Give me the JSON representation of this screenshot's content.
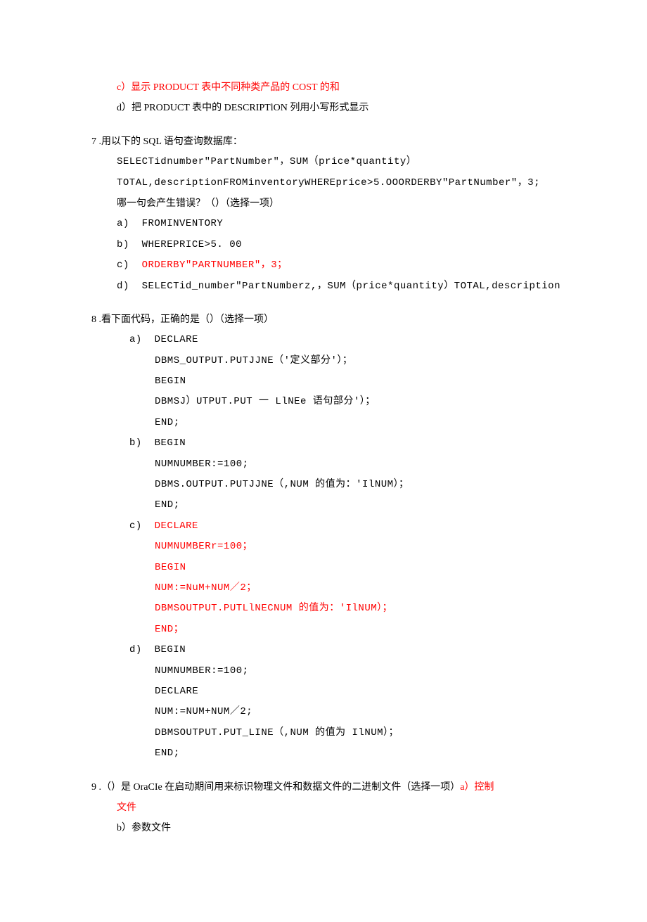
{
  "q6": {
    "c": "c）显示 PRODUCT 表中不同种类产品的 COST 的和",
    "d": "d）把 PRODUCT 表中的 DESCRIPTlON 列用小写形式显示"
  },
  "q7": {
    "num": "7 ",
    "stem": ".用以下的 SQL 语句查询数据库：",
    "line1": "SELECTidnumber\"PartNumber\"，SUM（price*quantity）",
    "line2": "TOTAL,descriptionFROMinventoryWHEREprice>5.OOORDERBY\"PartNumber\"，3;",
    "line3": "哪一句会产生错误？（）（选择一项）",
    "a": "a)  FROMINVENTORY",
    "b": "b)  WHEREPRICE>5. 00",
    "c": "c)  ",
    "c_red": "ORDERBY\"PARTNUMBER\"，3；",
    "d": "d)  SELECTid_number\"PartNumberz,，SUM（price*quantity）TOTAL,description"
  },
  "q8": {
    "num": "8 ",
    "stem": ".看下面代码，正确的是（）（选择一项）",
    "a_label": "a)  DECLARE",
    "a1": "DBMS_OUTPUT.PUTJJNE（'定义部分'）；",
    "a2": "BEGIN",
    "a3": "DBMSJ）UTPUT.PUT 一 LlNEe 语句部分'）；",
    "a4": "END;",
    "b_label": "b)  BEGIN",
    "b1": "NUMNUMBER:=100;",
    "b2": "DBMS.OUTPUT.PUTJJNE（,NUM 的值为：'IlNUM）；",
    "b3": "END;",
    "c_label": "c)  ",
    "c_red0": "DECLARE",
    "c1": "NUMNUMBERr=100；",
    "c2": "BEGIN",
    "c3": "NUM:=NuM+NUM／2；",
    "c4": "DBMSOUTPUT.PUTLlNECNUM 的值为：'IlNUM）；",
    "c5": "END；",
    "d_label": "d)  BEGIN",
    "d1": "NUMNUMBER:=100;",
    "d2": "DECLARE",
    "d3": "NUM:=NUM+NUM／2;",
    "d4": "DBMSOUTPUT.PUT_LINE（,NUM 的值为 IlNUM）；",
    "d5": "END;"
  },
  "q9": {
    "num": "9 ",
    "stem1": ".（）是 OraCIe 在启动期间用来标识物理文件和数据文件的二进制文件（选择一项）",
    "a_red": "a）控制",
    "a_red2": "文件",
    "b": "b）参数文件"
  }
}
